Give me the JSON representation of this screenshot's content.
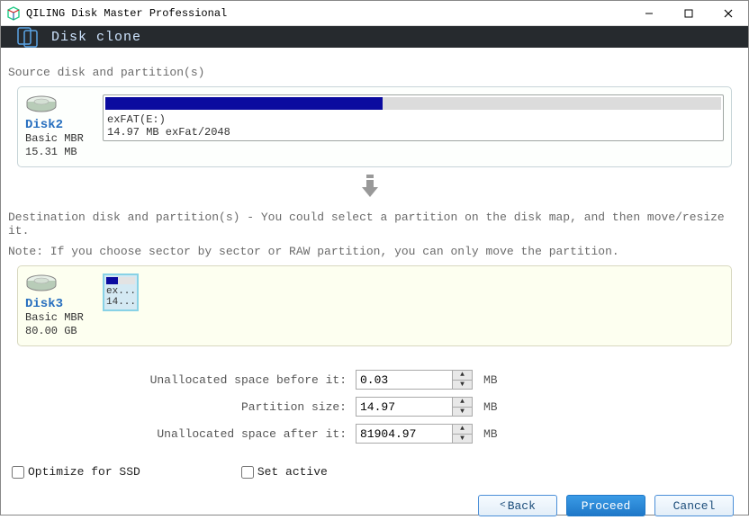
{
  "window": {
    "title": "QILING Disk Master Professional"
  },
  "head": {
    "title": "Disk clone"
  },
  "source": {
    "label": "Source disk and partition(s)",
    "disk": {
      "name": "Disk2",
      "type": "Basic MBR",
      "size": "15.31 MB",
      "partition": {
        "label": "exFAT(E:)",
        "detail": "14.97 MB exFat/2048",
        "used_pct": 45
      }
    }
  },
  "dest": {
    "label": "Destination disk and partition(s) - You could select a partition on the disk map, and then move/resize it.",
    "note": "Note: If you choose sector by sector or RAW partition, you can only move the partition.",
    "disk": {
      "name": "Disk3",
      "type": "Basic MBR",
      "size": "80.00 GB",
      "tile": {
        "l1": "ex...",
        "l2": "14..."
      }
    }
  },
  "spinners": {
    "before": {
      "label": "Unallocated space before it:",
      "value": "0.03",
      "unit": "MB"
    },
    "size": {
      "label": "Partition size:",
      "value": "14.97",
      "unit": "MB"
    },
    "after": {
      "label": "Unallocated space after it:",
      "value": "81904.97",
      "unit": "MB"
    }
  },
  "checks": {
    "ssd": "Optimize for SSD",
    "active": "Set active"
  },
  "buttons": {
    "back": "Back",
    "proceed": "Proceed",
    "cancel": "Cancel"
  }
}
